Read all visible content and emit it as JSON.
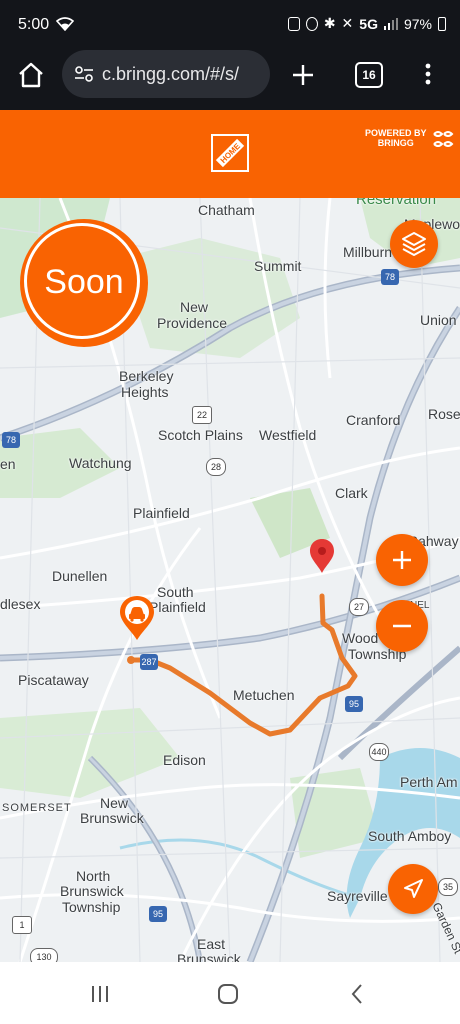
{
  "status": {
    "time": "5:00",
    "network": "5G",
    "battery": "97%"
  },
  "browser": {
    "url": "c.bringg.com/#/s/",
    "tab_count": "16"
  },
  "brand": {
    "powered_line1": "POWERED BY",
    "powered_line2": "BRINGG"
  },
  "eta": {
    "label": "Soon"
  },
  "map": {
    "places": {
      "chatham": "Chatham",
      "reservation": "Reservation",
      "maplewood": "Maplewo",
      "summit": "Summit",
      "millburn": "Millburn",
      "union": "Union",
      "new_providence_1": "New",
      "new_providence_2": "Providence",
      "berkeley_1": "Berkeley",
      "berkeley_2": "Heights",
      "rose": "Rose",
      "cranford": "Cranford",
      "scotch_plains": "Scotch Plains",
      "westfield": "Westfield",
      "watchung": "Watchung",
      "en": "en",
      "clark": "Clark",
      "plainfield": "Plainfield",
      "rahway": "Rahway",
      "dunellen": "Dunellen",
      "south_plainfield_1": "South",
      "south_plainfield_2": "Plainfield",
      "dlesex": "dlesex",
      "nel": "NEL",
      "woodbridge_1": "Wood",
      "woodbridge_2": "Township",
      "piscataway": "Piscataway",
      "metuchen": "Metuchen",
      "edison": "Edison",
      "somerset": "SOMERSET",
      "new_brunswick_1": "New",
      "new_brunswick_2": "Brunswick",
      "perth_amboy": "Perth Am",
      "south_amboy": "South Amboy",
      "nb_township_1": "North",
      "nb_township_2": "Brunswick",
      "nb_township_3": "Township",
      "sayreville": "Sayreville",
      "garden_state": "Garden St",
      "east_brunswick_1": "East",
      "east_brunswick_2": "Brunswick"
    },
    "shields": {
      "i78_left": "78",
      "i78_right": "78",
      "r22": "22",
      "r28": "28",
      "r27": "27",
      "i287": "287",
      "i95_a": "95",
      "r440": "440",
      "r1": "1",
      "r130": "130",
      "i95_b": "95",
      "r35": "35"
    }
  },
  "colors": {
    "accent": "#f96302",
    "route": "#e87a2b",
    "destination": "#e53935"
  },
  "icons": [
    "wifi-icon",
    "home-icon",
    "tune-icon",
    "plus-icon",
    "more-vert-icon",
    "layers-icon",
    "zoom-in-icon",
    "zoom-out-icon",
    "locate-icon",
    "car-pin-icon",
    "destination-pin-icon"
  ]
}
